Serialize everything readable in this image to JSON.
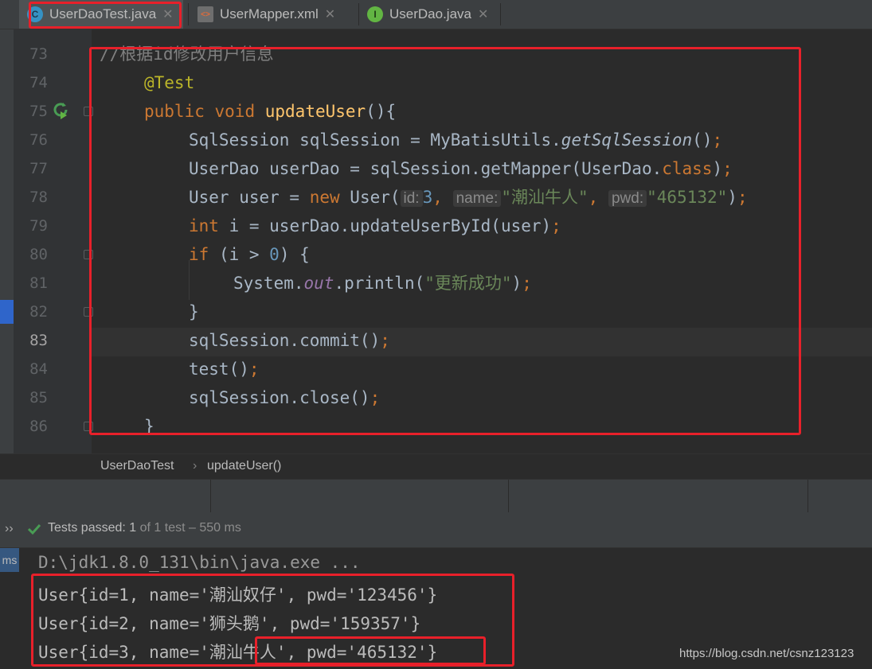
{
  "tabs": [
    {
      "label": "UserDaoTest.java",
      "icon": "java-class-icon",
      "active": true
    },
    {
      "label": "UserMapper.xml",
      "icon": "xml-file-icon",
      "active": false
    },
    {
      "label": "UserDao.java",
      "icon": "java-interface-icon",
      "active": false
    }
  ],
  "tab_icons": {
    "c": "C",
    "i": "I",
    "x": "<>"
  },
  "line_numbers": [
    "73",
    "74",
    "75",
    "76",
    "77",
    "78",
    "79",
    "80",
    "81",
    "82",
    "83",
    "84",
    "85",
    "86"
  ],
  "code": {
    "l73": {
      "comment": "//根据id修改用户信息"
    },
    "l74": {
      "annotation": "@Test"
    },
    "l75": {
      "kw1": "public",
      "kw2": "void",
      "method": "updateUser",
      "rest": "(){"
    },
    "l76": {
      "a": "SqlSession sqlSession = MyBatisUtils.",
      "method": "getSqlSession",
      "b": "()",
      "semi": ";"
    },
    "l77": {
      "a": "UserDao userDao = sqlSession.getMapper(UserDao.",
      "kw": "class",
      "b": ")",
      "semi": ";"
    },
    "l78": {
      "a": "User user = ",
      "kw": "new",
      "b": " User(",
      "hint_id": "id:",
      "num": "3",
      "comma1": ",",
      "hint_name": "name:",
      "str_name": "\"潮汕牛人\"",
      "comma2": ",",
      "hint_pwd": "pwd:",
      "str_pwd": "\"465132\"",
      "c": ")",
      "semi": ";"
    },
    "l79": {
      "kw": "int",
      "a": " i = userDao.updateUserById(user)",
      "semi": ";"
    },
    "l80": {
      "kw": "if",
      "a": " (i > ",
      "num": "0",
      "b": ") {"
    },
    "l81": {
      "a": "System.",
      "field": "out",
      "b": ".println(",
      "str": "\"更新成功\"",
      "c": ")",
      "semi": ";"
    },
    "l82": {
      "a": "}"
    },
    "l83": {
      "a": "sqlSession.commit()",
      "semi": ";"
    },
    "l84": {
      "a": "test()",
      "semi": ";"
    },
    "l85": {
      "a": "sqlSession.close()",
      "semi": ";"
    },
    "l86": {
      "a": "}"
    }
  },
  "breadcrumb": {
    "class": "UserDaoTest",
    "sep": "›",
    "method": "updateUser()"
  },
  "tests": {
    "expand": "››",
    "status": "Tests passed:",
    "count": "1",
    "detail": "of 1 test – 550 ms"
  },
  "console_tab": "ms",
  "console": [
    "D:\\jdk1.8.0_131\\bin\\java.exe ...",
    "User{id=1, name='潮汕奴仔', pwd='123456'}",
    "User{id=2, name='狮头鹅', pwd='159357'}",
    "User{id=3, name='潮汕牛人', pwd='465132'}"
  ],
  "watermark": "https://blog.csdn.net/csnz123123",
  "colors": {
    "accent_red": "#e8202a",
    "pass_green": "#499c54",
    "keyword": "#cc7832",
    "string": "#6a8759"
  }
}
